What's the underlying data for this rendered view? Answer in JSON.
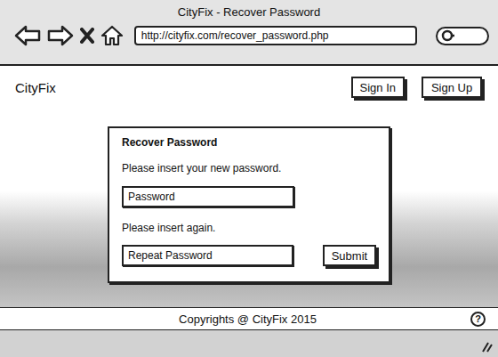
{
  "window": {
    "title": "CityFix - Recover Password"
  },
  "address_bar": {
    "url": "http://cityfix.com/recover_password.php"
  },
  "header": {
    "logo": "CityFix",
    "buttons": [
      "Sign In",
      "Sign Up"
    ]
  },
  "dialog": {
    "title": "Recover Password",
    "fields": [
      {
        "label": "Please insert your new password.",
        "placeholder": "Password"
      },
      {
        "label": "Please insert again.",
        "placeholder": "Repeat Password"
      }
    ],
    "submit": "Submit"
  },
  "footer": {
    "text": "Copyrights @ CityFix 2015",
    "help": "?"
  }
}
